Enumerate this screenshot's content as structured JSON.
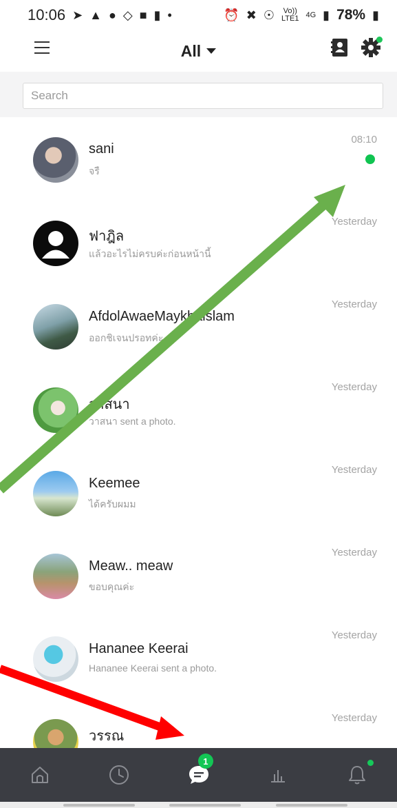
{
  "status_bar": {
    "time": "10:06",
    "battery": "78%",
    "network": "4G",
    "volte": "Vo))",
    "lte": "LTE1"
  },
  "header": {
    "title": "All"
  },
  "search": {
    "placeholder": "Search",
    "value": ""
  },
  "chats": [
    {
      "name": "sani",
      "preview": "จรื",
      "time": "08:10",
      "unread": true
    },
    {
      "name": "ฟาฎิล",
      "preview": "แล้วอะไรไม่ครบค่ะก่อนหน้านี้",
      "time": "Yesterday",
      "unread": false
    },
    {
      "name": "AfdolAwaeMaykhaislam",
      "preview": "ออกชิเจนปรอทค่ะ",
      "time": "Yesterday",
      "unread": false
    },
    {
      "name": "วาสนา",
      "preview": "วาสนา sent a photo.",
      "time": "Yesterday",
      "unread": false
    },
    {
      "name": "Keemee",
      "preview": "ได้ครับผมม",
      "time": "Yesterday",
      "unread": false
    },
    {
      "name": "Meaw.. meaw",
      "preview": "ขอบคุณค่ะ",
      "time": "Yesterday",
      "unread": false
    },
    {
      "name": "Hananee Keerai",
      "preview": "Hananee Keerai sent a photo.",
      "time": "Yesterday",
      "unread": false
    },
    {
      "name": "วรรณ",
      "preview": "",
      "time": "Yesterday",
      "unread": false
    }
  ],
  "bottom_nav": {
    "chat_badge": "1"
  },
  "colors": {
    "accent_green": "#10c451",
    "nav_bg": "#3b3d43",
    "arrow_green": "#6ab04c",
    "arrow_red": "#ff0000"
  },
  "icons": {
    "menu": "menu-icon",
    "contacts": "contacts-icon",
    "settings": "gear-icon",
    "home": "home-icon",
    "history": "clock-icon",
    "chats": "chat-bubble-icon",
    "stats": "bar-chart-icon",
    "notifications": "bell-icon"
  }
}
